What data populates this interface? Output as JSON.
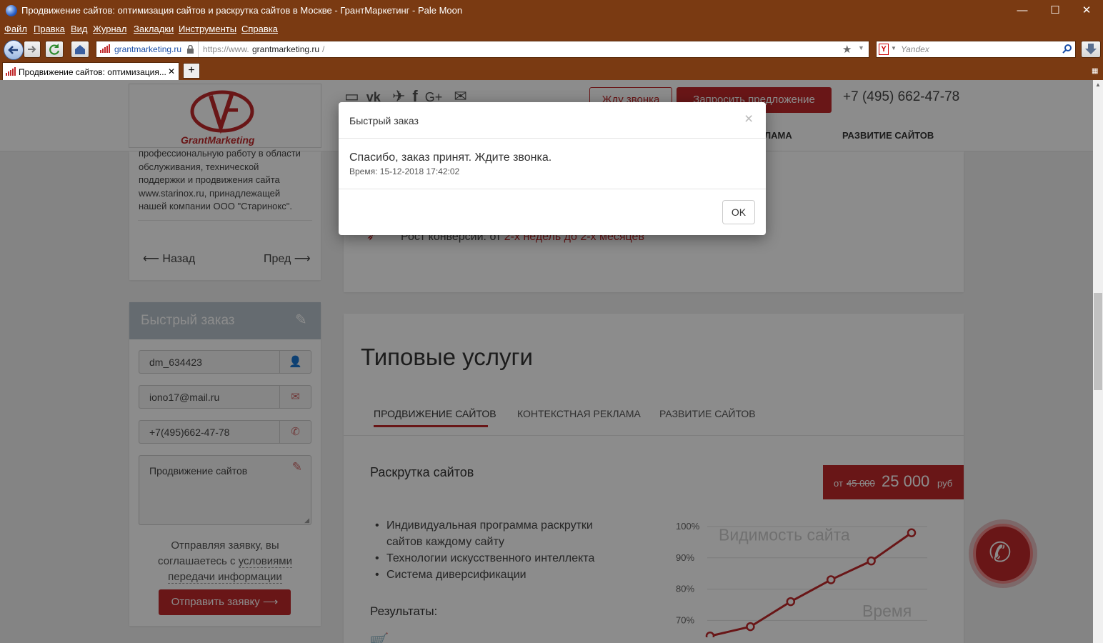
{
  "window": {
    "title": "Продвижение сайтов: оптимизация сайтов и раскрутка сайтов в Москве - ГрантМаркетинг - Pale Moon",
    "min": "—",
    "max": "☐",
    "close": "✕"
  },
  "menu": [
    "Файл",
    "Правка",
    "Вид",
    "Журнал",
    "Закладки",
    "Инструменты",
    "Справка"
  ],
  "nav": {
    "site_badge": "grantmarketing.ru",
    "url_prefix": "https://www.",
    "url_host": "grantmarketing.ru",
    "url_path": "/",
    "search_placeholder": "Yandex"
  },
  "tab": {
    "label": "Продвижение сайтов: оптимизация...",
    "close": "✕",
    "new": "+"
  },
  "header": {
    "logo_text": "GrantMarketing",
    "callback_btn": "Жду звонка",
    "offer_btn": "Запросить предложение",
    "phone": "+7 (495) 662-47-78",
    "nav_partial": "ЛАМА",
    "nav_dev": "РАЗВИТИЕ САЙТОВ"
  },
  "sidebar": {
    "text_lines": [
      "профессиональную работу в области",
      "обслуживания, технической",
      "поддержки и продвижения сайта",
      "www.starinox.ru, принадлежащей",
      "нашей компании ООО \"Старинокс\"."
    ],
    "prev": "Назад",
    "next": "Пред",
    "quick_title": "Быстрый заказ",
    "name_value": "dm_634423",
    "email_value": "iono17@mail.ru",
    "phone_value": "+7(495)662-47-78",
    "message_value": "Продвижение сайтов",
    "consent_l1": "Отправляя заявку, вы",
    "consent_l2": "соглашаетесь с ",
    "consent_link1": "условиями",
    "consent_link2": "передачи информации",
    "submit": "Отправить заявку"
  },
  "main": {
    "growth_label": "Рост конверсии: от ",
    "growth_value": "2-х недель до 2-х месяцев",
    "services_title": "Типовые услуги",
    "tabs": [
      "ПРОДВИЖЕНИЕ САЙТОВ",
      "КОНТЕКСТНАЯ РЕКЛАМА",
      "РАЗВИТИЕ САЙТОВ"
    ],
    "service_name": "Раскрутка сайтов",
    "price_from": "от ",
    "price_old": "45 000",
    "price_new": "25 000",
    "price_unit": "руб",
    "bullets": [
      "Индивидуальная программа раскрутки",
      "сайтов каждому сайту",
      "Технологии искусственного интеллекта",
      "Система диверсификации"
    ],
    "results_label": "Результаты:"
  },
  "chart_data": {
    "type": "line",
    "title": "Видимость сайта",
    "xlabel": "Время",
    "ylabel": "",
    "yticks": [
      "100%",
      "90%",
      "80%",
      "70%"
    ],
    "ylim": [
      62,
      100
    ],
    "values": [
      65,
      68,
      76,
      83,
      89,
      98
    ],
    "color": "#c0292b"
  },
  "modal": {
    "title": "Быстрый заказ",
    "close": "×",
    "message": "Спасибо, заказ принят. Ждите звонка.",
    "time_label": "Время: 15-12-2018 17:42:02",
    "ok": "OK"
  },
  "colors": {
    "chrome": "#7a3a12",
    "accent": "#c0292b"
  }
}
